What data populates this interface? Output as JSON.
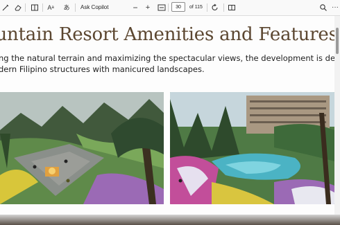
{
  "toolbar": {
    "ask_copilot": "Ask Copilot",
    "zoom_out": "−",
    "zoom_in": "+",
    "page_current": "30",
    "page_total": "of 115",
    "icons": [
      "draw-icon",
      "erase-icon",
      "text-box-icon",
      "read-aloud-icon",
      "translate-icon",
      "fit-page-icon",
      "rotate-icon",
      "two-page-view-icon",
      "search-icon",
      "more-icon"
    ]
  },
  "document": {
    "title": "ountain Resort Amenities and Features",
    "paragraph_line1": "ng the natural terrain and maximizing the spectacular views, the development is desig",
    "paragraph_line2": "dern Filipino structures with manicured landscapes."
  }
}
